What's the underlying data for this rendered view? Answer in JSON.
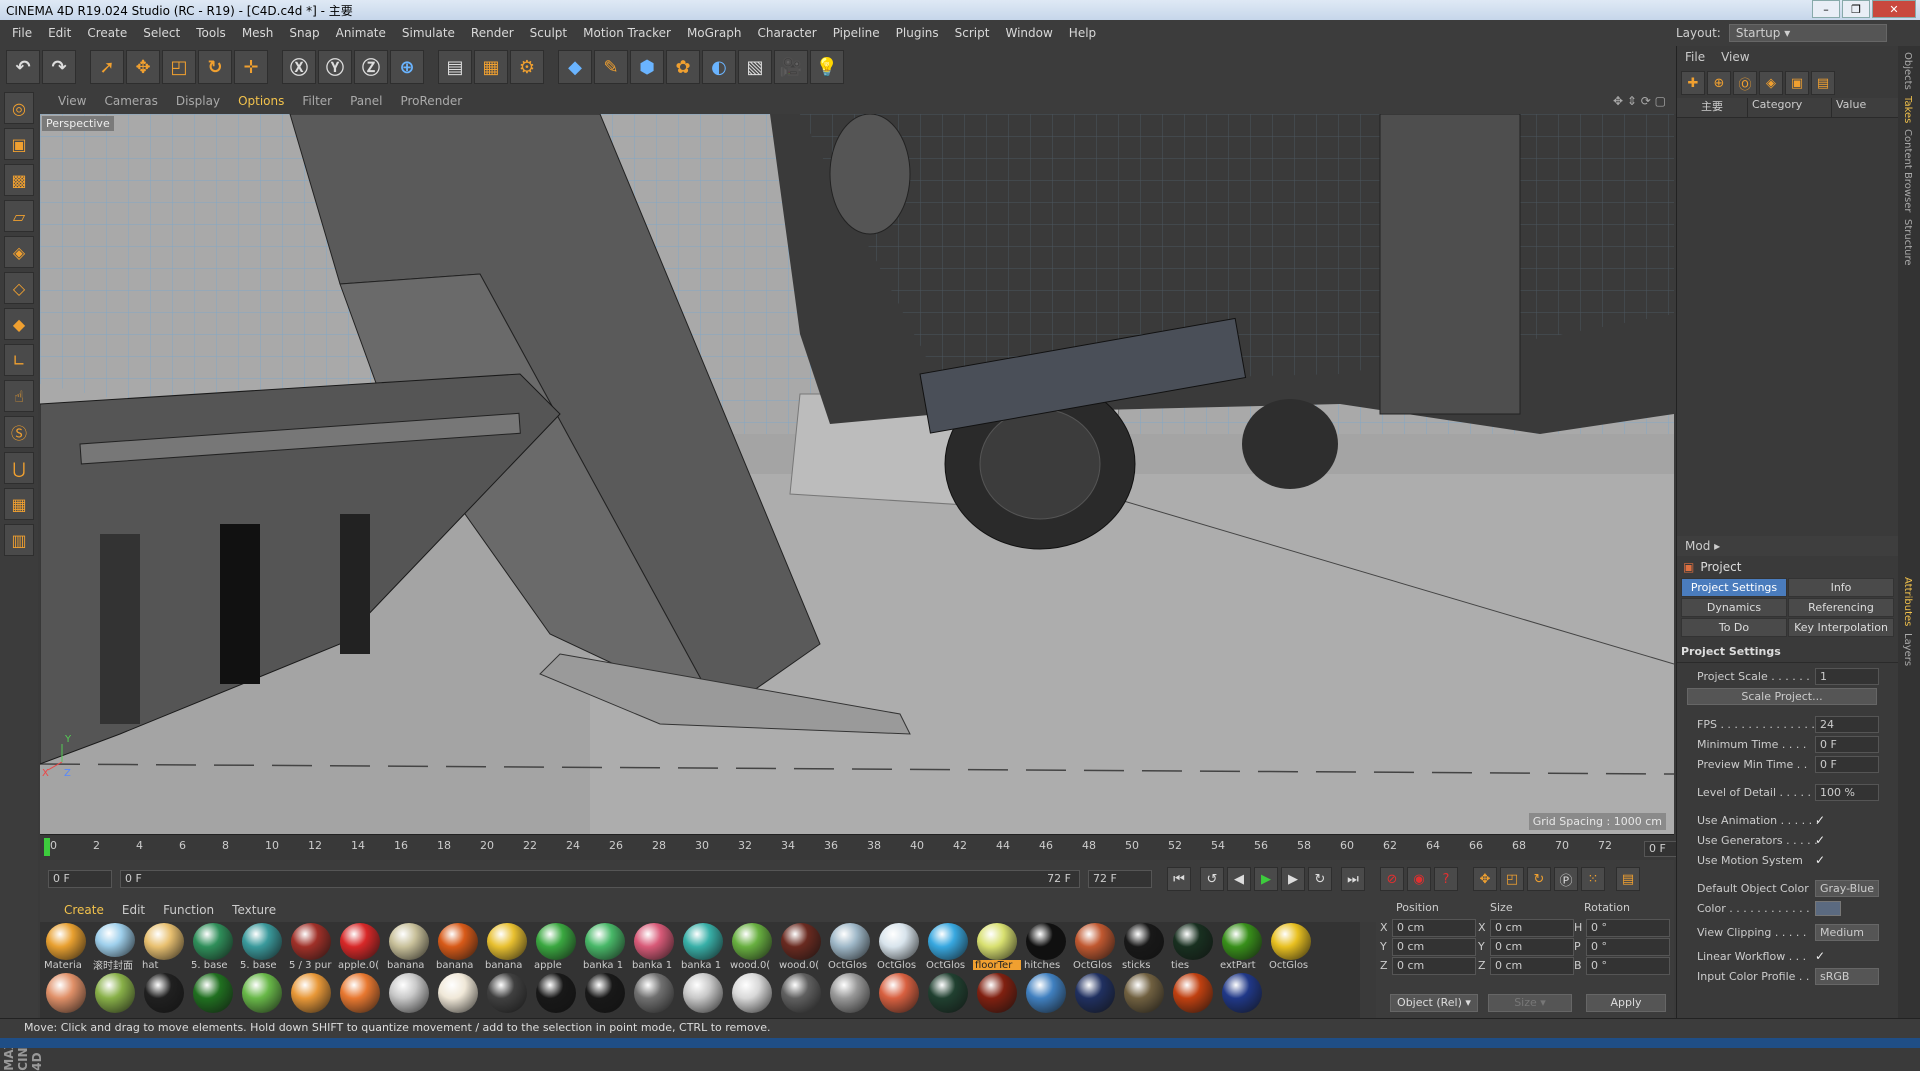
{
  "window": {
    "title": "CINEMA 4D R19.024 Studio (RC - R19) - [C4D.c4d *] - 主要"
  },
  "menu": [
    "File",
    "Edit",
    "Create",
    "Select",
    "Tools",
    "Mesh",
    "Snap",
    "Animate",
    "Simulate",
    "Render",
    "Sculpt",
    "Motion Tracker",
    "MoGraph",
    "Character",
    "Pipeline",
    "Plugins",
    "Script",
    "Window",
    "Help"
  ],
  "layout": {
    "label": "Layout:",
    "value": "Startup"
  },
  "viewport": {
    "menu": [
      "View",
      "Cameras",
      "Display",
      "Options",
      "Filter",
      "Panel",
      "ProRender"
    ],
    "active_menu": "Options",
    "camera_label": "Perspective",
    "grid_spacing": "Grid Spacing : 1000 cm"
  },
  "timeline": {
    "ticks": [
      "0",
      "2",
      "4",
      "6",
      "8",
      "10",
      "12",
      "14",
      "16",
      "18",
      "20",
      "22",
      "24",
      "26",
      "28",
      "30",
      "32",
      "34",
      "36",
      "38",
      "40",
      "42",
      "44",
      "46",
      "48",
      "50",
      "52",
      "54",
      "56",
      "58",
      "60",
      "62",
      "64",
      "66",
      "68",
      "70",
      "72"
    ],
    "current_frame": "0 F",
    "start": "0 F",
    "range_start": "0 F",
    "range_end": "72 F",
    "end": "72 F"
  },
  "materials": {
    "menu": [
      "Create",
      "Edit",
      "Function",
      "Texture"
    ],
    "active_menu": "Create",
    "row1": [
      {
        "name": "Materia",
        "color": "#e8a030"
      },
      {
        "name": "滚时封面",
        "color": "#9fd0ec"
      },
      {
        "name": "hat",
        "color": "#e8c070"
      },
      {
        "name": "5. base",
        "color": "#2f8f5a"
      },
      {
        "name": "5. base",
        "color": "#3a9a9c"
      },
      {
        "name": "5 / 3 pur",
        "color": "#a03028"
      },
      {
        "name": "apple.0(",
        "color": "#d82828"
      },
      {
        "name": "banana",
        "color": "#c8c09a"
      },
      {
        "name": "banana",
        "color": "#d85a18"
      },
      {
        "name": "banana",
        "color": "#e8c030"
      },
      {
        "name": "apple",
        "color": "#3aa840"
      },
      {
        "name": "banka 1",
        "color": "#48b868"
      },
      {
        "name": "banka 1",
        "color": "#d85a78"
      },
      {
        "name": "banka 1",
        "color": "#38b0a8"
      },
      {
        "name": "wood.0(",
        "color": "#68b040"
      },
      {
        "name": "wood.0(",
        "color": "#6a2a20"
      },
      {
        "name": "OctGlos",
        "color": "#9fb8c8"
      },
      {
        "name": "OctGlos",
        "color": "#d8e4ec"
      },
      {
        "name": "OctGlos",
        "color": "#38a8e0"
      },
      {
        "name": "floorTer",
        "color": "#d8e070",
        "selected": true
      },
      {
        "name": "hitches",
        "color": "#101010"
      },
      {
        "name": "OctGlos",
        "color": "#c05830"
      },
      {
        "name": "sticks",
        "color": "#181818"
      },
      {
        "name": "ties",
        "color": "#183020"
      },
      {
        "name": "extPart",
        "color": "#38901a"
      },
      {
        "name": "OctGlos",
        "color": "#e8c020"
      }
    ],
    "row2": [
      "#e09068",
      "#88b048",
      "#202020",
      "#207020",
      "#68b848",
      "#e89838",
      "#e87830",
      "#c8c8c8",
      "#f0e8d8",
      "#404040",
      "#181818",
      "#181818",
      "#707070",
      "#c8c8c8",
      "#d8d8d8",
      "#606060",
      "#989898",
      "#d86040",
      "#204030",
      "#802010",
      "#4080c0",
      "#203060",
      "#706040",
      "#c04010",
      "#203888"
    ]
  },
  "coords": {
    "headers": [
      "Position",
      "Size",
      "Rotation"
    ],
    "rows": [
      {
        "p": "X",
        "pv": "0 cm",
        "s": "X",
        "sv": "0 cm",
        "r": "H",
        "rv": "0 °"
      },
      {
        "p": "Y",
        "pv": "0 cm",
        "s": "Y",
        "sv": "0 cm",
        "r": "P",
        "rv": "0 °"
      },
      {
        "p": "Z",
        "pv": "0 cm",
        "s": "Z",
        "sv": "0 cm",
        "r": "B",
        "rv": "0 °"
      }
    ],
    "mode": "Object (Rel)",
    "size_mode": "Size",
    "apply": "Apply"
  },
  "status": "Move: Click and drag to move elements. Hold down SHIFT to quantize movement / add to the selection in point mode, CTRL to remove.",
  "objects": {
    "menu": [
      "File",
      "View"
    ],
    "root": "主要",
    "headers": [
      "Category",
      "Value"
    ]
  },
  "side_tabs_top": [
    "Objects",
    "Takes",
    "Content Browser",
    "Structure"
  ],
  "side_tabs_bottom": [
    "Attributes",
    "Layers"
  ],
  "attributes": {
    "mode": "Mod",
    "title": "Project",
    "tabs": [
      "Project Settings",
      "Info",
      "Dynamics",
      "Referencing",
      "To Do",
      "Key Interpolation"
    ],
    "active_tab": "Project Settings",
    "section": "Project Settings",
    "project_scale_label": "Project Scale . . . . . .",
    "project_scale": "1",
    "scale_button": "Scale Project...",
    "fps_label": "FPS . . . . . . . . . . . . . .",
    "fps": "24",
    "min_time_label": "Minimum Time . . . .",
    "min_time": "0 F",
    "preview_min_label": "Preview Min Time . .",
    "preview_min": "0 F",
    "lod_label": "Level of Detail . . . . .",
    "lod": "100 %",
    "use_animation": "Use Animation . . . . . .",
    "use_generators": "Use Generators . . . . .",
    "use_motion": "Use Motion System",
    "default_color_label": "Default Object Color",
    "default_color": "Gray-Blue",
    "color_label": "Color . . . . . . . . . . . .",
    "view_clipping_label": "View Clipping . . . . .",
    "view_clipping": "Medium",
    "linear_workflow": "Linear Workflow . . .",
    "input_color_label": "Input Color Profile . .",
    "input_color": "sRGB",
    "check": "✓"
  }
}
